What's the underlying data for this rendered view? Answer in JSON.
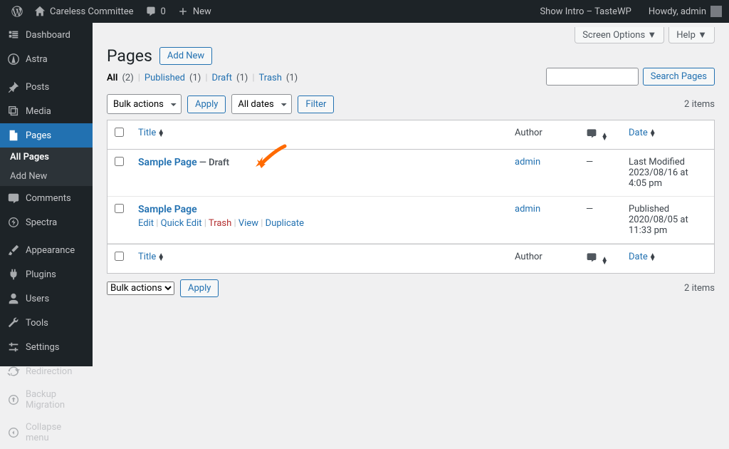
{
  "adminbar": {
    "site_name": "Careless Committee",
    "comments_count": "0",
    "new_label": "New",
    "show_intro": "Show Intro – TasteWP",
    "howdy": "Howdy, admin"
  },
  "sidebar": {
    "items": [
      {
        "label": "Dashboard"
      },
      {
        "label": "Astra"
      },
      {
        "label": "Posts"
      },
      {
        "label": "Media"
      },
      {
        "label": "Pages"
      },
      {
        "label": "Comments"
      },
      {
        "label": "Spectra"
      },
      {
        "label": "Appearance"
      },
      {
        "label": "Plugins"
      },
      {
        "label": "Users"
      },
      {
        "label": "Tools"
      },
      {
        "label": "Settings"
      },
      {
        "label": "Redirection"
      },
      {
        "label": "Backup Migration"
      },
      {
        "label": "Collapse menu"
      }
    ],
    "submenu": {
      "all_pages": "All Pages",
      "add_new": "Add New"
    }
  },
  "screen_options": "Screen Options",
  "help": "Help",
  "page_title": "Pages",
  "add_new": "Add New",
  "filters": {
    "all": "All",
    "all_count": "(2)",
    "published": "Published",
    "published_count": "(1)",
    "draft": "Draft",
    "draft_count": "(1)",
    "trash": "Trash",
    "trash_count": "(1)"
  },
  "search_button": "Search Pages",
  "bulk_actions": "Bulk actions",
  "apply": "Apply",
  "all_dates": "All dates",
  "filter": "Filter",
  "items_count": "2 items",
  "columns": {
    "title": "Title",
    "author": "Author",
    "date": "Date"
  },
  "rows": [
    {
      "title": "Sample Page",
      "state": " — Draft",
      "author": "admin",
      "comments": "—",
      "date_label": "Last Modified",
      "date_value": "2023/08/16 at 4:05 pm",
      "show_actions": false
    },
    {
      "title": "Sample Page",
      "state": "",
      "author": "admin",
      "comments": "—",
      "date_label": "Published",
      "date_value": "2020/08/05 at 11:33 pm",
      "show_actions": true
    }
  ],
  "row_actions": {
    "edit": "Edit",
    "quick_edit": "Quick Edit",
    "trash": "Trash",
    "view": "View",
    "duplicate": "Duplicate"
  }
}
